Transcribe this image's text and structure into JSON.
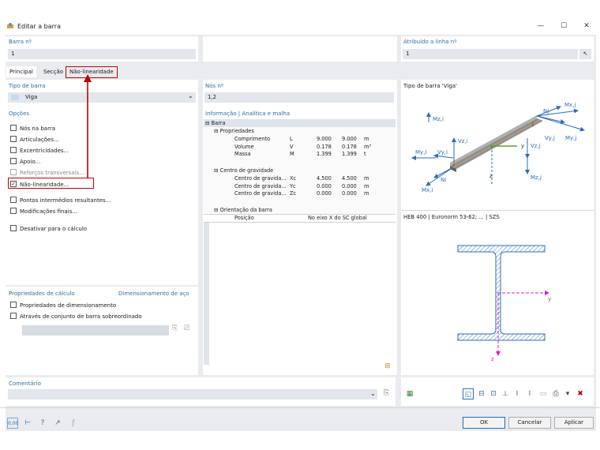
{
  "window": {
    "title": "Editar a barra",
    "minimize": "—",
    "maximize": "☐",
    "close": "✕"
  },
  "barra": {
    "label": "Barra nº",
    "value": "1"
  },
  "atribuido": {
    "label": "Atribuído a linha nº",
    "value": "1"
  },
  "tabs": [
    {
      "label": "Principal"
    },
    {
      "label": "Secção"
    },
    {
      "label": "Não-linearidade"
    }
  ],
  "tipo": {
    "label": "Tipo de barra",
    "value": "Viga",
    "dropdown": "⌄"
  },
  "opcoes": {
    "label": "Opções",
    "items": [
      {
        "label": "Nós na barra",
        "checked": false,
        "disabled": false
      },
      {
        "label": "Articulações...",
        "checked": false,
        "disabled": false
      },
      {
        "label": "Excentricidades...",
        "checked": false,
        "disabled": false
      },
      {
        "label": "Apoio...",
        "checked": false,
        "disabled": false
      },
      {
        "label": "Reforços transversais...",
        "checked": false,
        "disabled": true
      },
      {
        "label": "Não-linearidade...",
        "checked": true,
        "disabled": false
      },
      {
        "label": "Pontos intermédios resultantes...",
        "checked": false,
        "disabled": false
      },
      {
        "label": "Modificações finais...",
        "checked": false,
        "disabled": false
      },
      {
        "label": "Desativar para o cálculo",
        "checked": false,
        "disabled": false
      }
    ]
  },
  "calc": {
    "label": "Propriedades de cálculo",
    "right": "Dimensionamento de aço",
    "items": [
      {
        "label": "Propriedades de dimensionamento"
      },
      {
        "label": "Através de conjunto de barra sobreordinado"
      }
    ]
  },
  "nos": {
    "label": "Nós nº",
    "value": "1,2"
  },
  "info": {
    "label": "Informação | Analítica e malha",
    "barra": "Barra",
    "propriedades": "Propriedades",
    "props": [
      {
        "name": "Comprimento",
        "sym": "L",
        "v1": "9.000",
        "v2": "9.000",
        "unit": "m"
      },
      {
        "name": "Volume",
        "sym": "V",
        "v1": "0.178",
        "v2": "0.178",
        "unit": "m³"
      },
      {
        "name": "Massa",
        "sym": "M",
        "v1": "1.399",
        "v2": "1.399",
        "unit": "t"
      }
    ],
    "cg": "Centro de gravidade",
    "cgs": [
      {
        "name": "Centro de gravida...",
        "sym": "Xc",
        "v1": "4.500",
        "v2": "4.500",
        "unit": "m"
      },
      {
        "name": "Centro de gravida...",
        "sym": "Yc",
        "v1": "0.000",
        "v2": "0.000",
        "unit": "m"
      },
      {
        "name": "Centro de gravida...",
        "sym": "Zc",
        "v1": "0.000",
        "v2": "0.000",
        "unit": "m"
      }
    ],
    "orient": "Orientação da barra",
    "pos": {
      "name": "Posição",
      "value": "No eixo X do SC global"
    }
  },
  "tipo_view": {
    "label": "Tipo de barra 'Viga'",
    "labels": {
      "mxj": "Mx,j",
      "nj": "Nj",
      "j": "j",
      "vzj": "Vz,j",
      "vyj": "Vy,j",
      "myj": "My,j",
      "vzj2": "Vz,j",
      "mzj": "Mz,j",
      "mzi": "Mz,i",
      "vzi": "Vz,i",
      "myi": "My,i",
      "vyi": "Vy,i",
      "i": "i",
      "ni": "Ni",
      "mxi": "Mx,i",
      "y": "y",
      "z": "z"
    }
  },
  "section": {
    "label": "HEB 400 | Euronorm 53-62; ... | SZS",
    "y": "y",
    "z": "z"
  },
  "comentario": {
    "label": "Comentário",
    "value": ""
  },
  "buttons": {
    "ok": "OK",
    "cancel": "Cancelar",
    "apply": "Aplicar"
  },
  "footer_icons": [
    "0,00",
    "dimension-icon",
    "help-icon",
    "arrow-icon",
    "formula-icon"
  ]
}
